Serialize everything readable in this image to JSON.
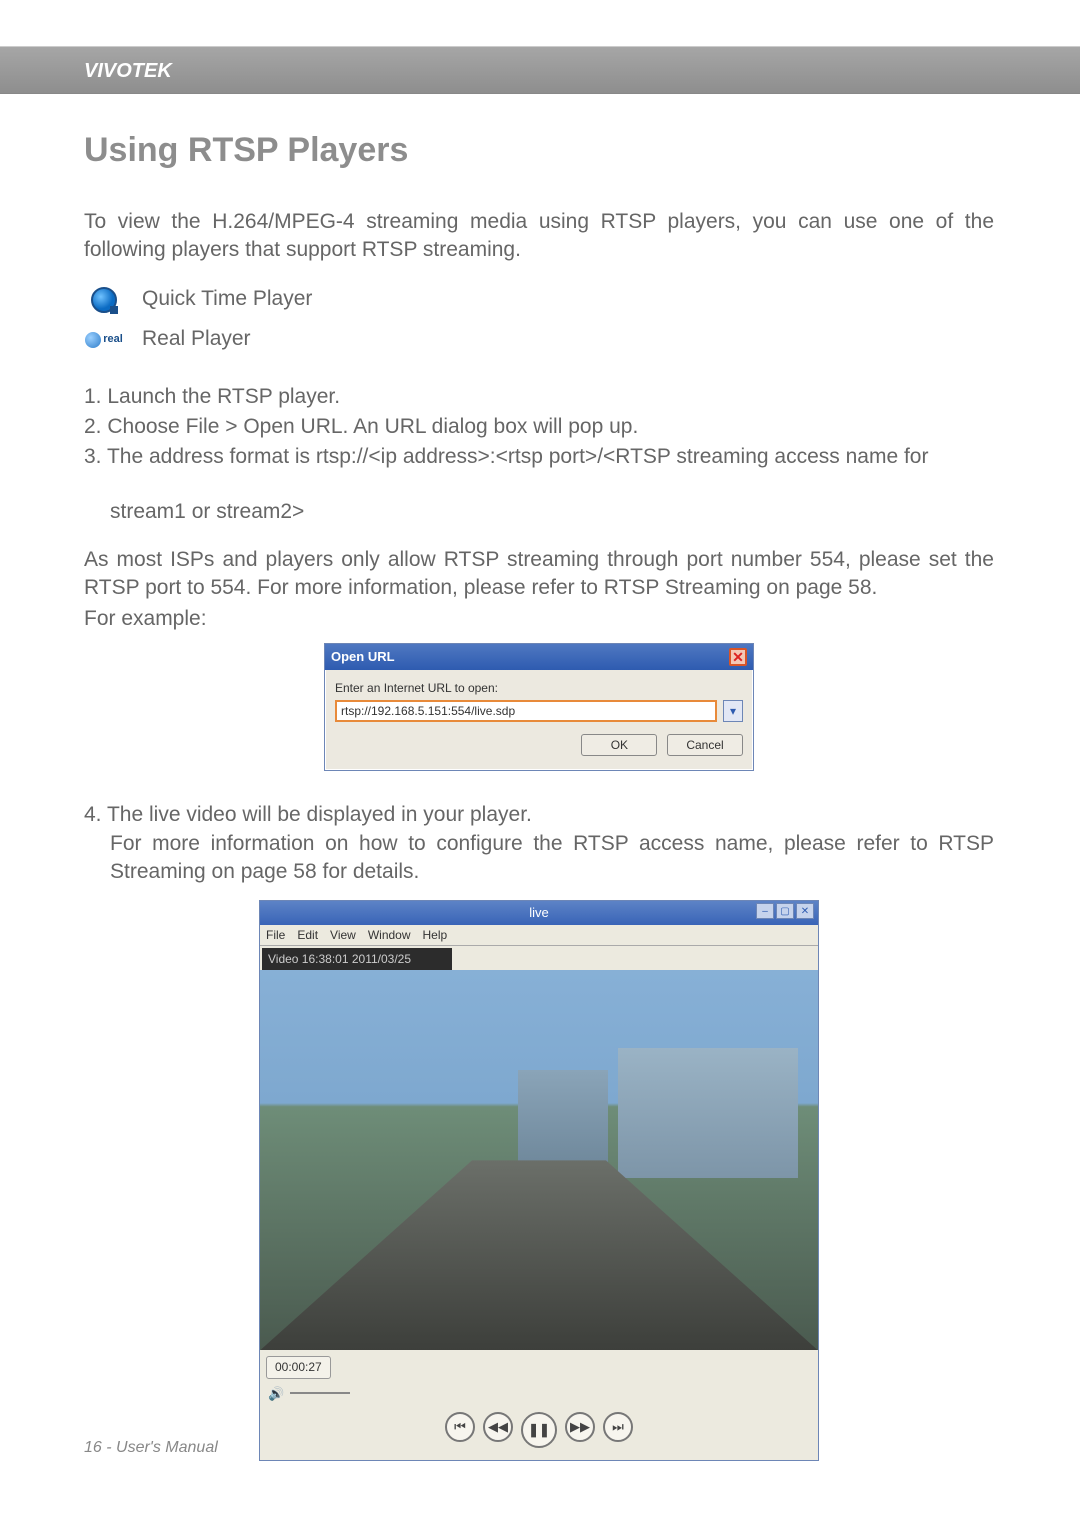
{
  "brand": "VIVOTEK",
  "title": "Using RTSP Players",
  "intro": "To view the H.264/MPEG-4 streaming media using RTSP players, you can use one of the following players that support RTSP streaming.",
  "players": {
    "quicktime": "Quick Time Player",
    "realplayer": "Real Player"
  },
  "steps": {
    "s1": "1. Launch the RTSP player.",
    "s2": "2. Choose File > Open URL. An URL dialog box will pop up.",
    "s3a": "3. The address format is rtsp://<ip address>:<rtsp port>/<RTSP streaming access name for",
    "s3b": "stream1 or stream2>"
  },
  "midpara": "As most ISPs and players only allow RTSP streaming through port number 554, please set the RTSP port to 554. For more information, please refer to RTSP Streaming on page 58.",
  "forexample": "For example:",
  "dialog": {
    "title": "Open URL",
    "label": "Enter an Internet URL to open:",
    "url": "rtsp://192.168.5.151:554/live.sdp",
    "ok": "OK",
    "cancel": "Cancel"
  },
  "step4a": "4. The live video will be displayed in your player.",
  "step4b": "For more information on how to configure the RTSP access name, please refer to RTSP Streaming on page 58 for details.",
  "playerwin": {
    "title": "live",
    "menu": {
      "file": "File",
      "edit": "Edit",
      "view": "View",
      "window": "Window",
      "help": "Help"
    },
    "overlay": "Video 16:38:01 2011/03/25",
    "time": "00:00:27"
  },
  "footer": "16 - User's Manual"
}
